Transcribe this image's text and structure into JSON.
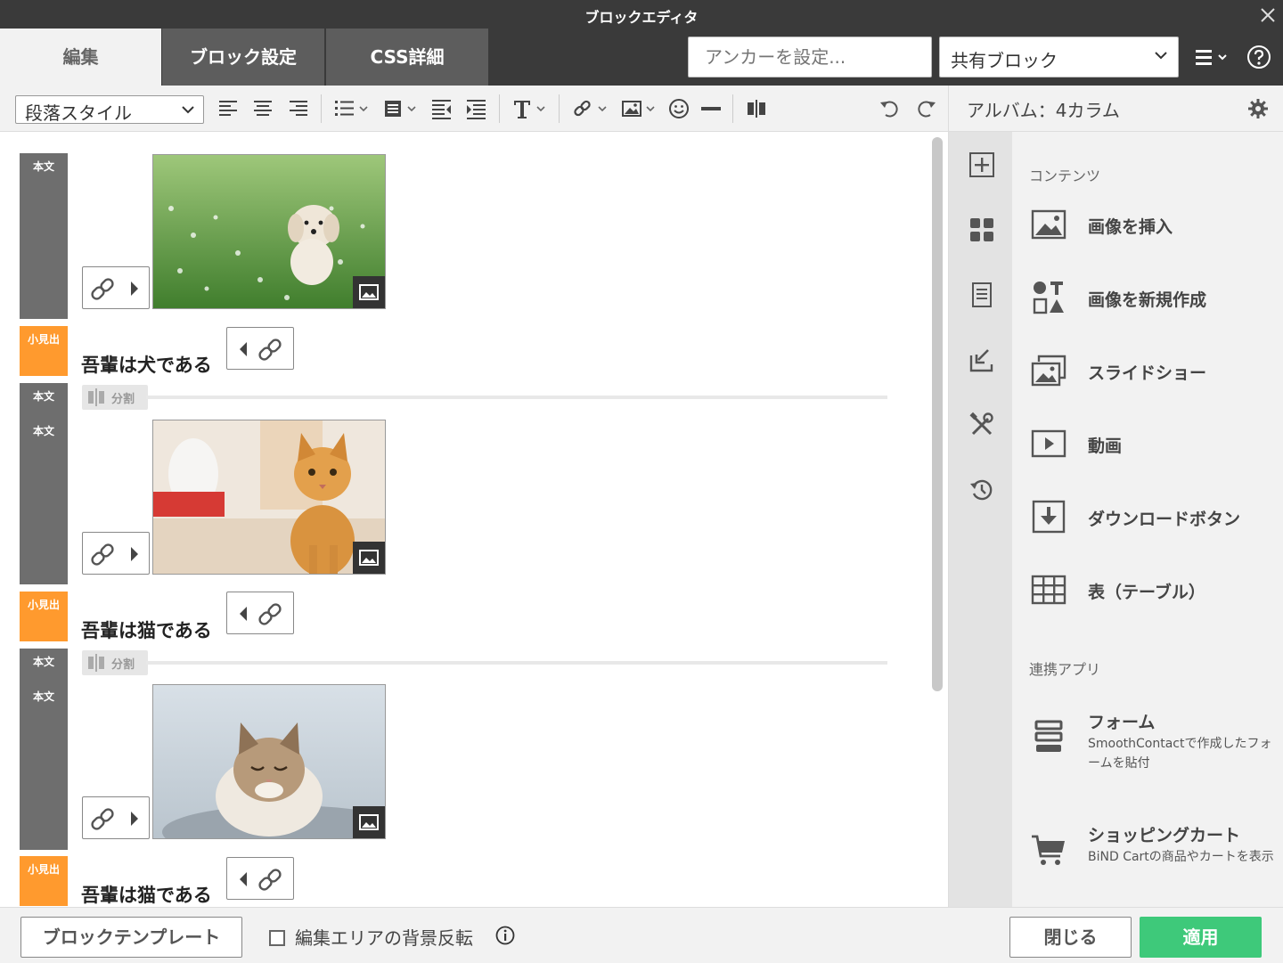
{
  "window": {
    "title": "ブロックエディタ"
  },
  "tabs": {
    "edit": "編集",
    "block_settings": "ブロック設定",
    "css": "CSS詳細"
  },
  "header": {
    "anchor_placeholder": "アンカーを設定...",
    "shared_block": "共有ブロック"
  },
  "toolbar": {
    "paragraph_style": "段落スタイル"
  },
  "panel": {
    "title": "アルバム：4カラム",
    "section_contents": "コンテンツ",
    "items": [
      {
        "label": "画像を挿入",
        "icon": "image-icon"
      },
      {
        "label": "画像を新規作成",
        "icon": "shapes-icon"
      },
      {
        "label": "スライドショー",
        "icon": "slideshow-icon"
      },
      {
        "label": "動画",
        "icon": "video-icon"
      },
      {
        "label": "ダウンロードボタン",
        "icon": "download-icon"
      },
      {
        "label": "表（テーブル）",
        "icon": "table-icon"
      }
    ],
    "section_apps": "連携アプリ",
    "apps": [
      {
        "label": "フォーム",
        "desc": "SmoothContactで作成したフォームを貼付",
        "icon": "form-icon"
      },
      {
        "label": "ショッピングカート",
        "desc": "BiND Cartの商品やカートを表示",
        "icon": "cart-icon"
      }
    ]
  },
  "editor": {
    "tag_body": "本文",
    "tag_heading": "小見出",
    "divider_label": "分割",
    "headings": [
      "吾輩は犬である",
      "吾輩は猫である",
      "吾輩は猫である"
    ]
  },
  "footer": {
    "template_button": "ブロックテンプレート",
    "invert_bg_label": "編集エリアの背景反転",
    "close_button": "閉じる",
    "apply_button": "適用"
  },
  "colors": {
    "heading_tag": "#ff9a2e",
    "body_tag": "#6e6e6e",
    "apply": "#3ec97a",
    "titlebar": "#3a3a3a"
  }
}
